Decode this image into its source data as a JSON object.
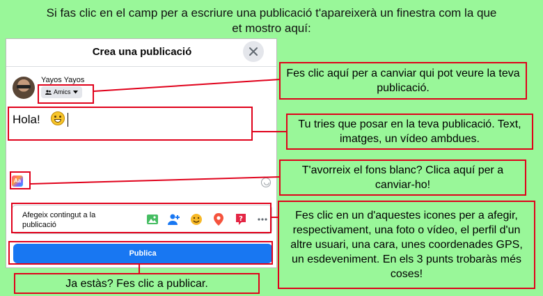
{
  "intro": {
    "line1": "Si fas clic en el camp per a escriure una publicació t'apareixerà un finestra com la que",
    "line2": "et mostro aquí:"
  },
  "dialog": {
    "title": "Crea una publicació",
    "close_icon": "close-icon",
    "user": {
      "name": "Yayos Yayos",
      "privacy_label": "Amics"
    },
    "post_text": "Hola!",
    "background_button_label": "Aa",
    "add_to_post_label": "Afegeix contingut a la publicació",
    "add_icons": [
      "photo-video-icon",
      "tag-people-icon",
      "feeling-icon",
      "location-icon",
      "event-icon",
      "more-icon"
    ],
    "publish_label": "Publica"
  },
  "annotations": {
    "privacy": "Fes clic aquí per a canviar qui pot veure la teva publicació.",
    "content": "Tu tries que posar en la teva publicació. Text, imatges, un vídeo ambdues.",
    "background": "T'avorreix el fons blanc? Clica aquí per a canviar-ho!",
    "icons": "Fes clic en un d'aquestes icones per a afegir, respectivament, una foto o vídeo, el perfil d'un altre usuari, una cara, unes coordenades GPS, un esdeveniment. En els 3 punts trobaràs més coses!",
    "publish": "Ja estàs? Fes clic a publicar."
  },
  "colors": {
    "background": "#99f799",
    "annotation_border": "#e0001a",
    "publish_button": "#1877f2"
  }
}
